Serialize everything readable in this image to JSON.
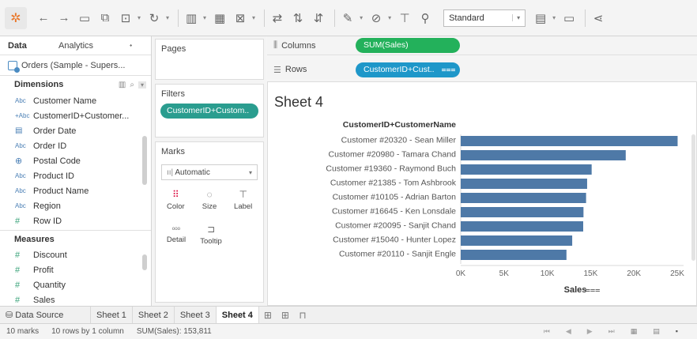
{
  "toolbar": {
    "fit_select": "Standard"
  },
  "datapane": {
    "tab_data": "Data",
    "tab_analytics": "Analytics",
    "datasource": "Orders (Sample - Supers...",
    "dimensions_header": "Dimensions",
    "dimensions": [
      {
        "icon": "Abc",
        "label": "Customer Name"
      },
      {
        "icon": "+Abc",
        "label": "CustomerID+Customer..."
      },
      {
        "icon": "calendar",
        "label": "Order Date"
      },
      {
        "icon": "Abc",
        "label": "Order ID"
      },
      {
        "icon": "globe",
        "label": "Postal Code"
      },
      {
        "icon": "Abc",
        "label": "Product ID"
      },
      {
        "icon": "Abc",
        "label": "Product Name"
      },
      {
        "icon": "Abc",
        "label": "Region"
      },
      {
        "icon": "#",
        "label": "Row ID"
      }
    ],
    "measures_header": "Measures",
    "measures": [
      {
        "icon": "#",
        "label": "Discount"
      },
      {
        "icon": "#",
        "label": "Profit"
      },
      {
        "icon": "#",
        "label": "Quantity"
      },
      {
        "icon": "#",
        "label": "Sales"
      }
    ]
  },
  "cards": {
    "pages_title": "Pages",
    "filters_title": "Filters",
    "filter_pill": "CustomerID+Custom..",
    "marks_title": "Marks",
    "marks_type": "Automatic",
    "marks_buttons": [
      {
        "label": "Color",
        "icon": "color-dots-icon"
      },
      {
        "label": "Size",
        "icon": "size-icon"
      },
      {
        "label": "Label",
        "icon": "label-icon"
      },
      {
        "label": "Detail",
        "icon": "detail-icon"
      },
      {
        "label": "Tooltip",
        "icon": "tooltip-icon"
      }
    ]
  },
  "shelves": {
    "columns_label": "Columns",
    "columns_pill": "SUM(Sales)",
    "rows_label": "Rows",
    "rows_pill": "CustomerID+Cust.."
  },
  "sheet": {
    "title": "Sheet 4"
  },
  "chart_data": {
    "type": "bar",
    "orientation": "horizontal",
    "row_header": "CustomerID+CustomerName",
    "categories": [
      "Customer #20320 - Sean Miller",
      "Customer #20980 - Tamara Chand",
      "Customer #19360 - Raymond Buch",
      "Customer #21385 - Tom Ashbrook",
      "Customer #10105 - Adrian Barton",
      "Customer #16645 - Ken Lonsdale",
      "Customer #20095 - Sanjit Chand",
      "Customer #15040 - Hunter Lopez",
      "Customer #20110 - Sanjit Engle"
    ],
    "values": [
      25043,
      19052,
      15117,
      14595,
      14474,
      14175,
      14142,
      12873,
      12209
    ],
    "xlabel": "Sales",
    "xticks": [
      "0K",
      "5K",
      "10K",
      "15K",
      "20K",
      "25K"
    ],
    "xlim": [
      0,
      25000
    ],
    "bar_color": "#4e79a7"
  },
  "tabs": {
    "datasource": "Data Source",
    "sheets": [
      "Sheet 1",
      "Sheet 2",
      "Sheet 3",
      "Sheet 4"
    ],
    "active": "Sheet 4"
  },
  "status": {
    "marks": "10 marks",
    "rows": "10 rows by 1 column",
    "sum": "SUM(Sales): 153,811"
  }
}
